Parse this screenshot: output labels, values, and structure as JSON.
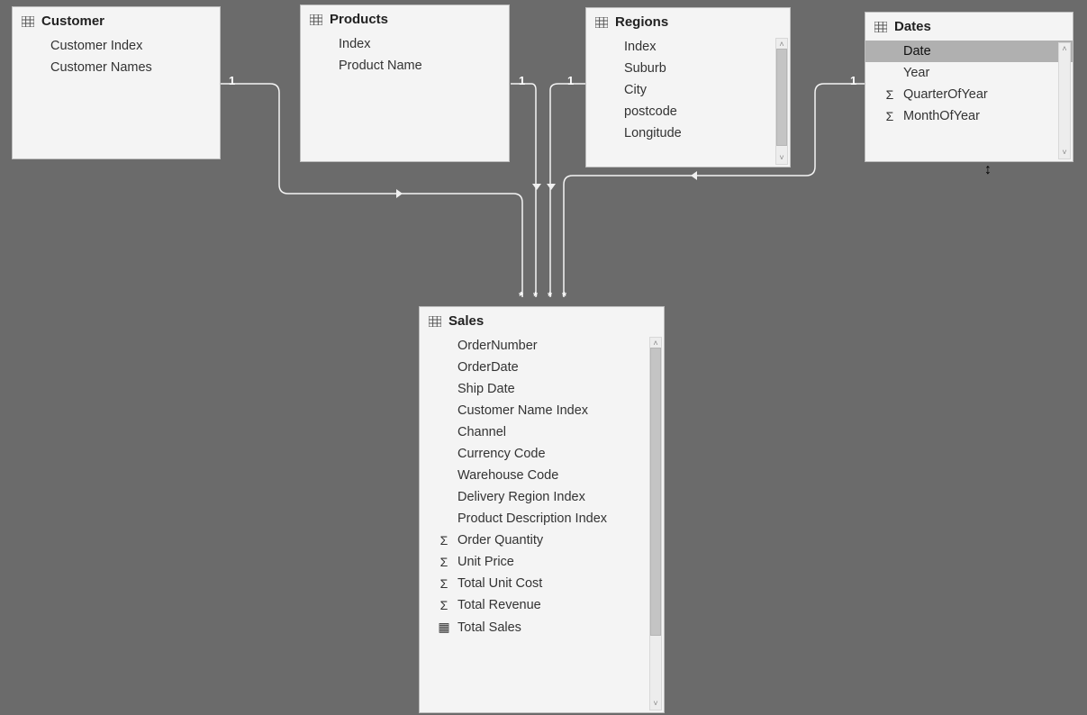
{
  "tables": {
    "customer": {
      "title": "Customer",
      "fields": [
        "Customer Index",
        "Customer Names"
      ]
    },
    "products": {
      "title": "Products",
      "fields": [
        "Index",
        "Product Name"
      ]
    },
    "regions": {
      "title": "Regions",
      "fields": [
        "Index",
        "Suburb",
        "City",
        "postcode",
        "Longitude"
      ]
    },
    "dates": {
      "title": "Dates",
      "fields": [
        {
          "label": "Date",
          "selected": true
        },
        {
          "label": "Year"
        },
        {
          "label": "QuarterOfYear",
          "icon": "sigma"
        },
        {
          "label": "MonthOfYear",
          "icon": "sigma"
        }
      ]
    },
    "sales": {
      "title": "Sales",
      "fields": [
        {
          "label": "OrderNumber"
        },
        {
          "label": "OrderDate"
        },
        {
          "label": "Ship Date"
        },
        {
          "label": "Customer Name Index"
        },
        {
          "label": "Channel"
        },
        {
          "label": "Currency Code"
        },
        {
          "label": "Warehouse Code"
        },
        {
          "label": "Delivery Region Index"
        },
        {
          "label": "Product Description Index"
        },
        {
          "label": "Order Quantity",
          "icon": "sigma"
        },
        {
          "label": "Unit Price",
          "icon": "sigma"
        },
        {
          "label": "Total Unit Cost",
          "icon": "sigma"
        },
        {
          "label": "Total Revenue",
          "icon": "sigma"
        },
        {
          "label": "Total Sales",
          "icon": "calc"
        }
      ]
    }
  },
  "cardinality": {
    "one": "1",
    "many": "*"
  },
  "glyphs": {
    "sigma": "Σ",
    "calc": "▦"
  }
}
